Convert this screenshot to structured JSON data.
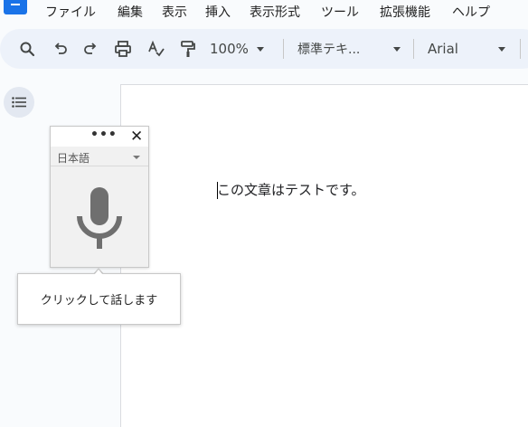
{
  "menu": [
    "ファイル",
    "編集",
    "表示",
    "挿入",
    "表示形式",
    "ツール",
    "拡張機能",
    "ヘルプ"
  ],
  "toolbar": {
    "zoom": "100%",
    "style": "標準テキ...",
    "font": "Arial",
    "icons": [
      "search-icon",
      "undo-icon",
      "redo-icon",
      "print-icon",
      "spellcheck-icon",
      "paint-format-icon"
    ]
  },
  "document": {
    "text": "この文章はテストです。"
  },
  "voice_typing": {
    "more": "•••",
    "close": "✕",
    "language": "日本語",
    "tooltip": "クリックして話します"
  }
}
